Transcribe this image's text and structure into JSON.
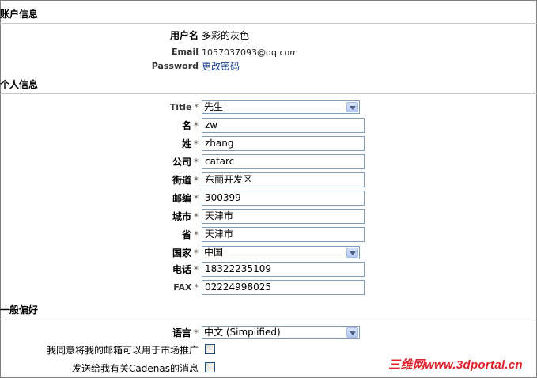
{
  "account": {
    "heading": "账户信息",
    "username_label": "用户名",
    "username": "多彩的灰色",
    "email_label": "Email",
    "email": "1057037093@qq.com",
    "password_label": "Password",
    "password_link": "更改密码"
  },
  "personal": {
    "heading": "个人信息",
    "required_mark": "*",
    "fields": [
      {
        "label": "Title",
        "value": "先生"
      },
      {
        "label": "名",
        "value": "zw"
      },
      {
        "label": "姓",
        "value": "zhang"
      },
      {
        "label": "公司",
        "value": "catarc"
      },
      {
        "label": "街道",
        "value": "东丽开发区"
      },
      {
        "label": "邮编",
        "value": "300399"
      },
      {
        "label": "城市",
        "value": "天津市"
      },
      {
        "label": "省",
        "value": "天津市"
      },
      {
        "label": "国家",
        "value": "中国"
      },
      {
        "label": "电话",
        "value": "18322235109"
      },
      {
        "label": "FAX",
        "value": "02224998025"
      }
    ]
  },
  "preferences": {
    "heading": "一般偏好",
    "language_label": "语言",
    "language_value": "中文 (Simplified)",
    "marketing_label": "我同意将我的邮箱可以用于市场推广",
    "marketing_checked": false,
    "cadenas_label": "发送给我有关Cadenas的消息",
    "cadenas_checked": false
  },
  "watermark": "三维网www.3dportal.cn"
}
